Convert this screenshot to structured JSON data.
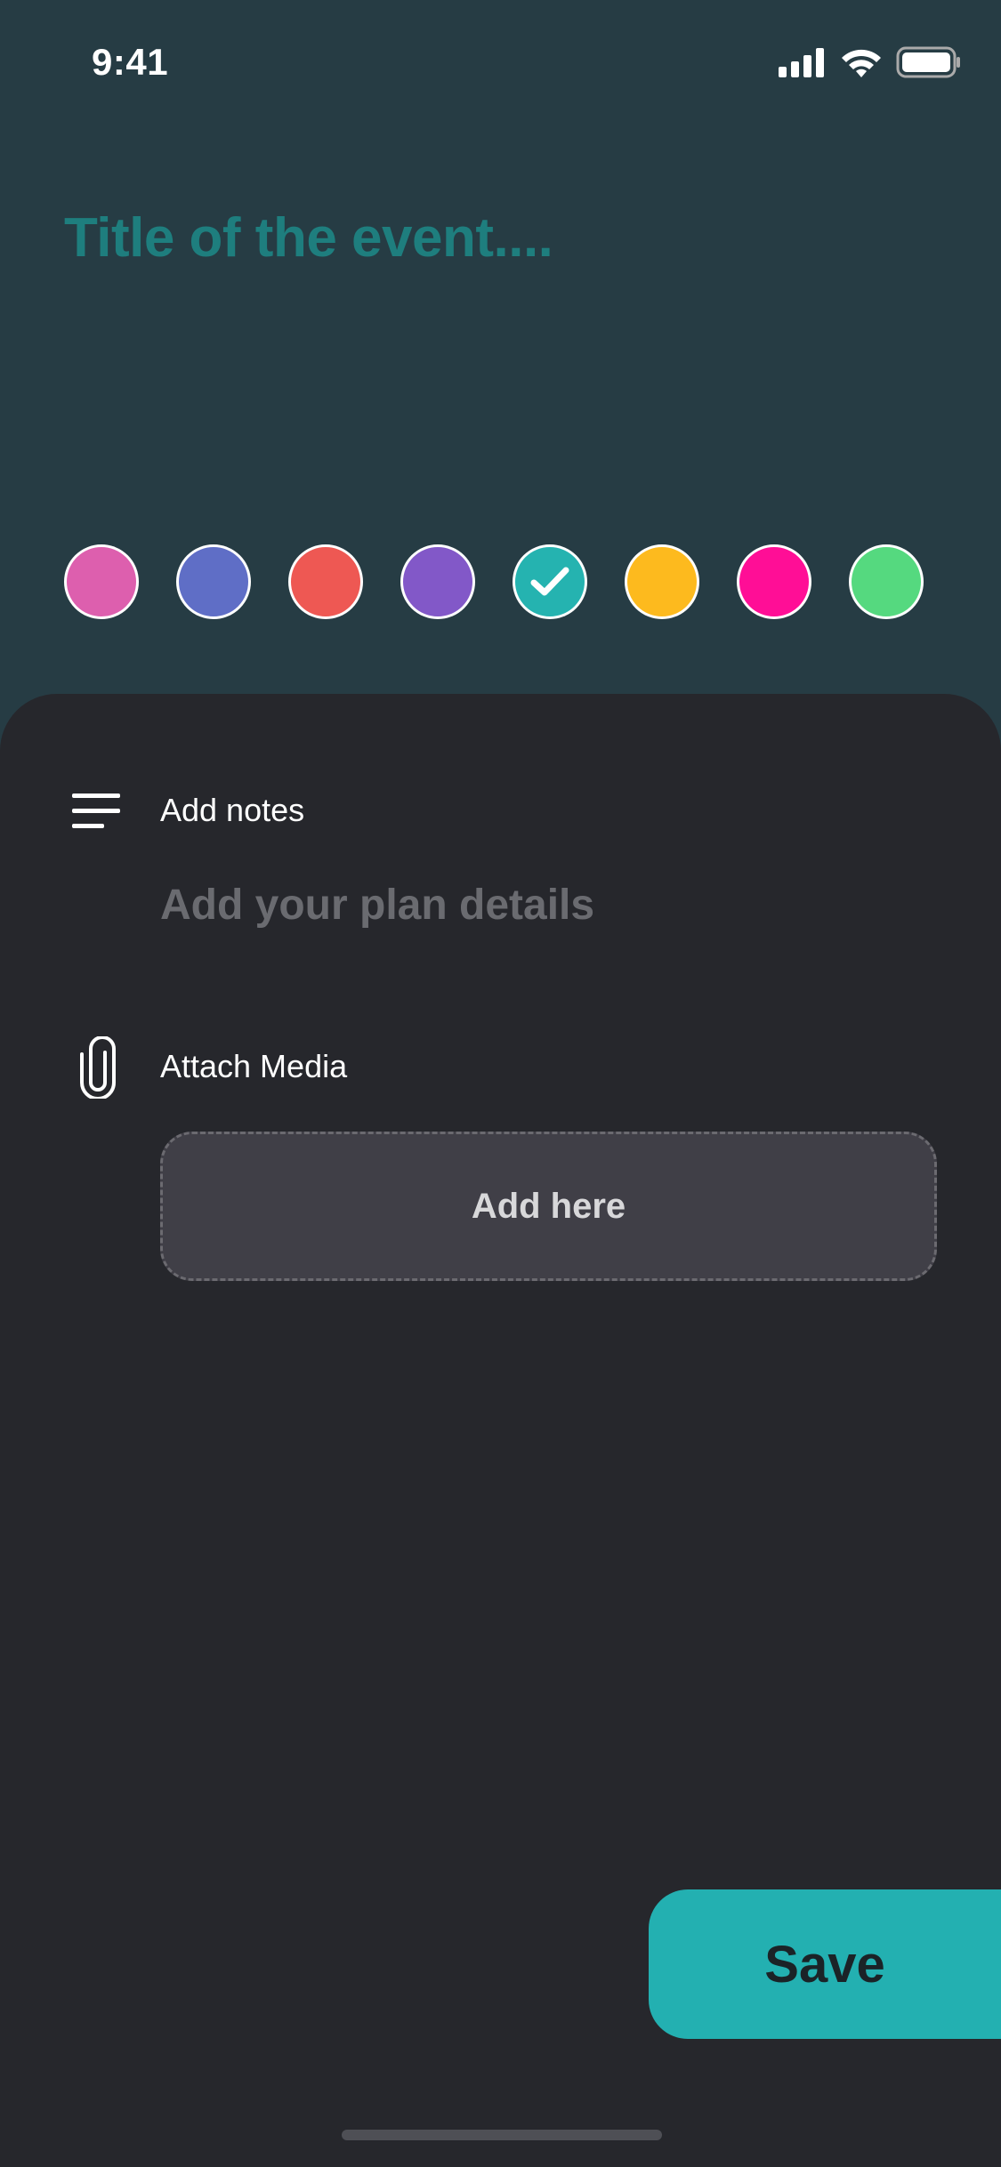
{
  "status_bar": {
    "time": "9:41",
    "icons": [
      "cellular-signal-icon",
      "wifi-icon",
      "battery-icon"
    ]
  },
  "event": {
    "title_placeholder": "Title of the event....",
    "title_color": "#1E7E7E"
  },
  "color_picker": {
    "selected_index": 4,
    "swatches": [
      {
        "name": "pink",
        "color": "#DD5FAE"
      },
      {
        "name": "indigo",
        "color": "#5F6EC6"
      },
      {
        "name": "red",
        "color": "#EE5853"
      },
      {
        "name": "purple",
        "color": "#8258C8"
      },
      {
        "name": "teal",
        "color": "#25B3B0"
      },
      {
        "name": "amber",
        "color": "#FDBA1E"
      },
      {
        "name": "magenta",
        "color": "#FF0E96"
      },
      {
        "name": "green",
        "color": "#55D97F"
      }
    ]
  },
  "notes": {
    "label": "Add notes",
    "placeholder": "Add your plan details",
    "icon": "lines-icon"
  },
  "media": {
    "label": "Attach Media",
    "add_label": "Add here",
    "icon": "paperclip-icon"
  },
  "actions": {
    "save_label": "Save",
    "save_color": "#23B0B1"
  }
}
